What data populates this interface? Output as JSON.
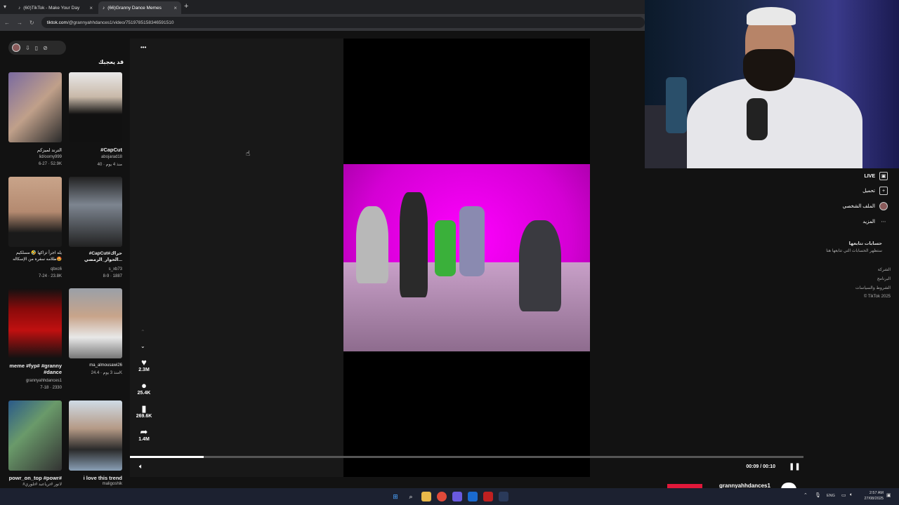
{
  "browser": {
    "tabs": [
      {
        "title": "(60)TikTok - Make Your Day",
        "active": false
      },
      {
        "title": "(66)Granny Dance Memes",
        "active": true
      }
    ],
    "url_domain": "tiktok.com",
    "url_path": "/@grannyahhdances1/video/7519785158346591510"
  },
  "left": {
    "section_title": "قد يعجبك",
    "videos": [
      {
        "caption": "الترند لميزكم",
        "user": "lid/oomy999",
        "meta": "6-27 · 52.9K"
      },
      {
        "caption": "#CapCut",
        "user": "abojarad18",
        "meta": "40 · منذ 4 يوم"
      },
      {
        "caption": "يله اجرأ تزاكها 🤣 مسلكيم طلامه سفره من الإسكاله🤩",
        "user": "qbxc6",
        "meta": "7-24 · 23.8K"
      },
      {
        "caption": "#CapCut#حراك الحوار_الرمضي...",
        "user": "s_xb73",
        "meta": "8-9 · 1887"
      },
      {
        "caption": "meme #fyp# #granny #dance",
        "user": "grannyahhdances1",
        "meta": "7-18 · 2330"
      },
      {
        "caption": "",
        "user": "ma_almousawi26",
        "meta": "منذ 3 يوم · 24.4K"
      },
      {
        "caption": "powr_on_top #powr#",
        "user": "#لانور #ترياعبد #تلوري",
        "meta": ""
      },
      {
        "caption": "i love this trend",
        "user": "maligoshik",
        "meta": ""
      }
    ]
  },
  "video": {
    "actions": [
      {
        "icon": "heart-icon",
        "glyph": "♥",
        "count": "2.3M"
      },
      {
        "icon": "comment-icon",
        "glyph": "●",
        "count": "25.4K"
      },
      {
        "icon": "bookmark-icon",
        "glyph": "▮",
        "count": "269.6K"
      },
      {
        "icon": "share-icon",
        "glyph": "➦",
        "count": "1.4M"
      }
    ],
    "more_glyph": "•••",
    "time": "00:09 / 00:10",
    "progress": 0.11
  },
  "right_nav": {
    "items": [
      {
        "label": "LIVE",
        "icon": "live-icon"
      },
      {
        "label": "تحميل",
        "icon": "upload-icon"
      },
      {
        "label": "الملف الشخصي",
        "icon": "profile-icon"
      },
      {
        "label": "المزيد",
        "icon": "more-icon"
      }
    ],
    "following_title": "حسابات تتابعها",
    "following_sub": "ستظهر الحسابات التي تتابعها هنا",
    "footer": [
      "الشركة",
      "البرنامج",
      "الشروط والسياسات",
      "© TikTok 2025"
    ]
  },
  "stream": {
    "name": "grannyahhdances1"
  },
  "taskbar": {
    "lang": "ENG",
    "time": "2:57 AM",
    "date": "27/08/2025"
  }
}
